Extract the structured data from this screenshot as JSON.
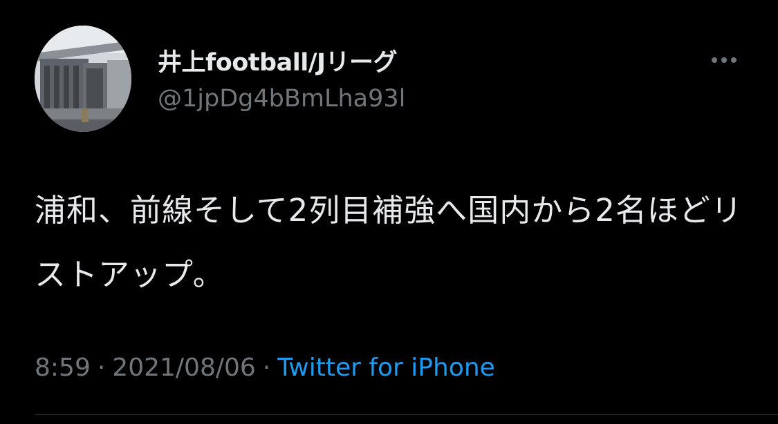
{
  "user": {
    "display_name": "井上football/Jリーグ",
    "handle": "@1jpDg4bBmLha93l"
  },
  "tweet": {
    "text": "浦和、前線そして2列目補強へ国内から2名ほどリストアップ。",
    "time": "8:59",
    "separator": "·",
    "date": "2021/08/06",
    "source": "Twitter for iPhone"
  },
  "icons": {
    "more": "more-horizontal-icon",
    "avatar": "stadium-photo"
  },
  "colors": {
    "background": "#000000",
    "primary_text": "#e7e9ea",
    "secondary_text": "#71767b",
    "link": "#1d9bf0",
    "divider": "#2f3336"
  }
}
